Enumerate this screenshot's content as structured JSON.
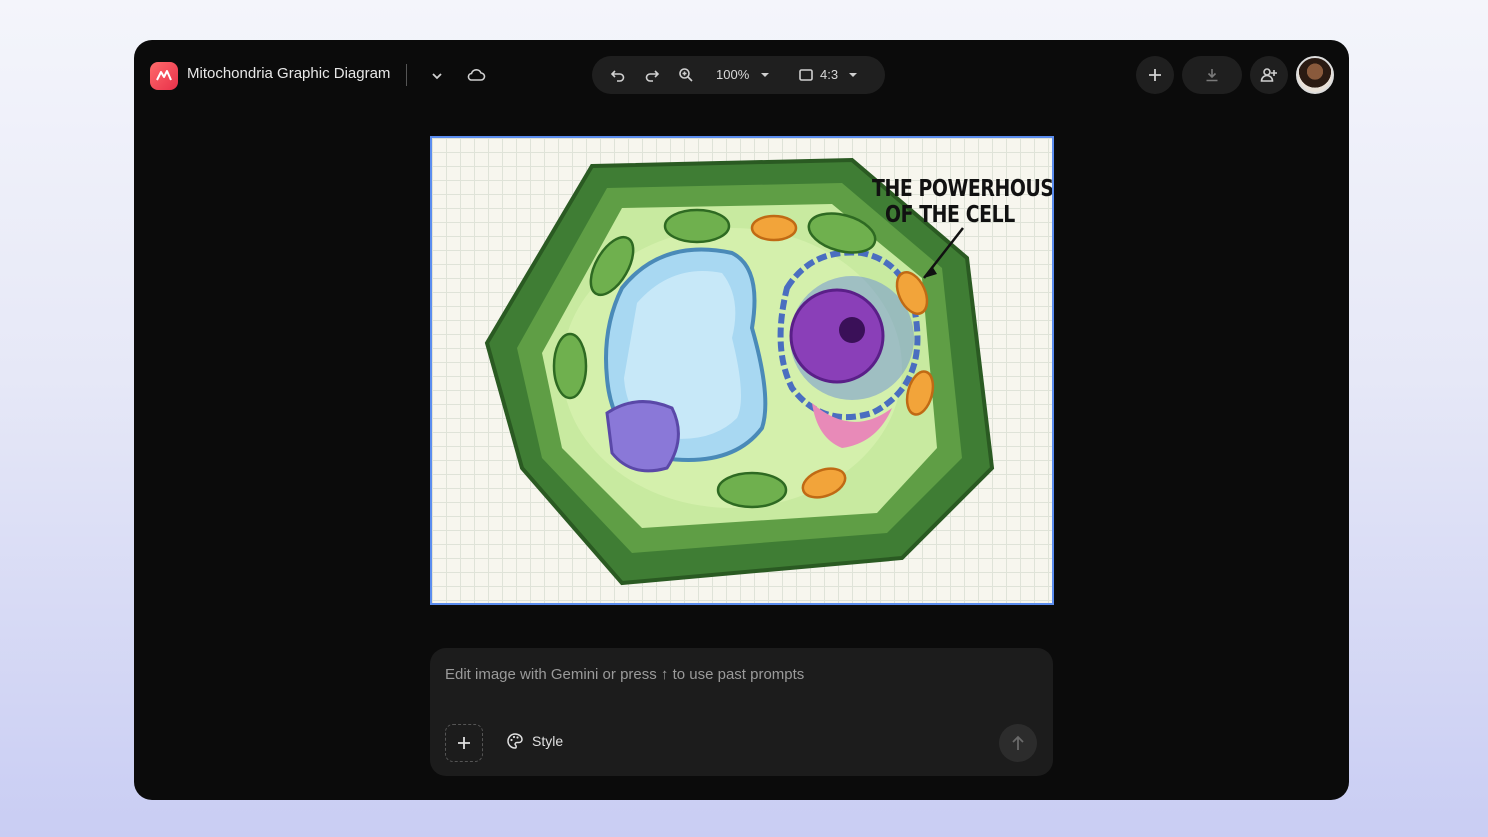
{
  "header": {
    "doc_title": "Mitochondria Graphic Diagram",
    "zoom": "100%",
    "aspect_ratio": "4:3"
  },
  "canvas": {
    "caption_line1": "THE POWERHOUSE",
    "caption_line2": "OF THE CELL"
  },
  "prompt": {
    "placeholder": "Edit image with Gemini or press ↑ to use past prompts",
    "style_label": "Style"
  },
  "colors": {
    "accent": "#5b8def",
    "app_logo": "#e8304a",
    "window_bg": "#0b0b0b"
  },
  "icons": {
    "app": "app-logo-icon",
    "dropdown": "chevron-down-icon",
    "cloud": "cloud-icon",
    "undo": "undo-icon",
    "redo": "redo-icon",
    "zoom": "zoom-in-icon",
    "aspect": "aspect-ratio-icon",
    "add": "plus-icon",
    "download": "download-icon",
    "share": "add-person-icon",
    "style": "palette-icon",
    "send": "arrow-up-icon"
  }
}
